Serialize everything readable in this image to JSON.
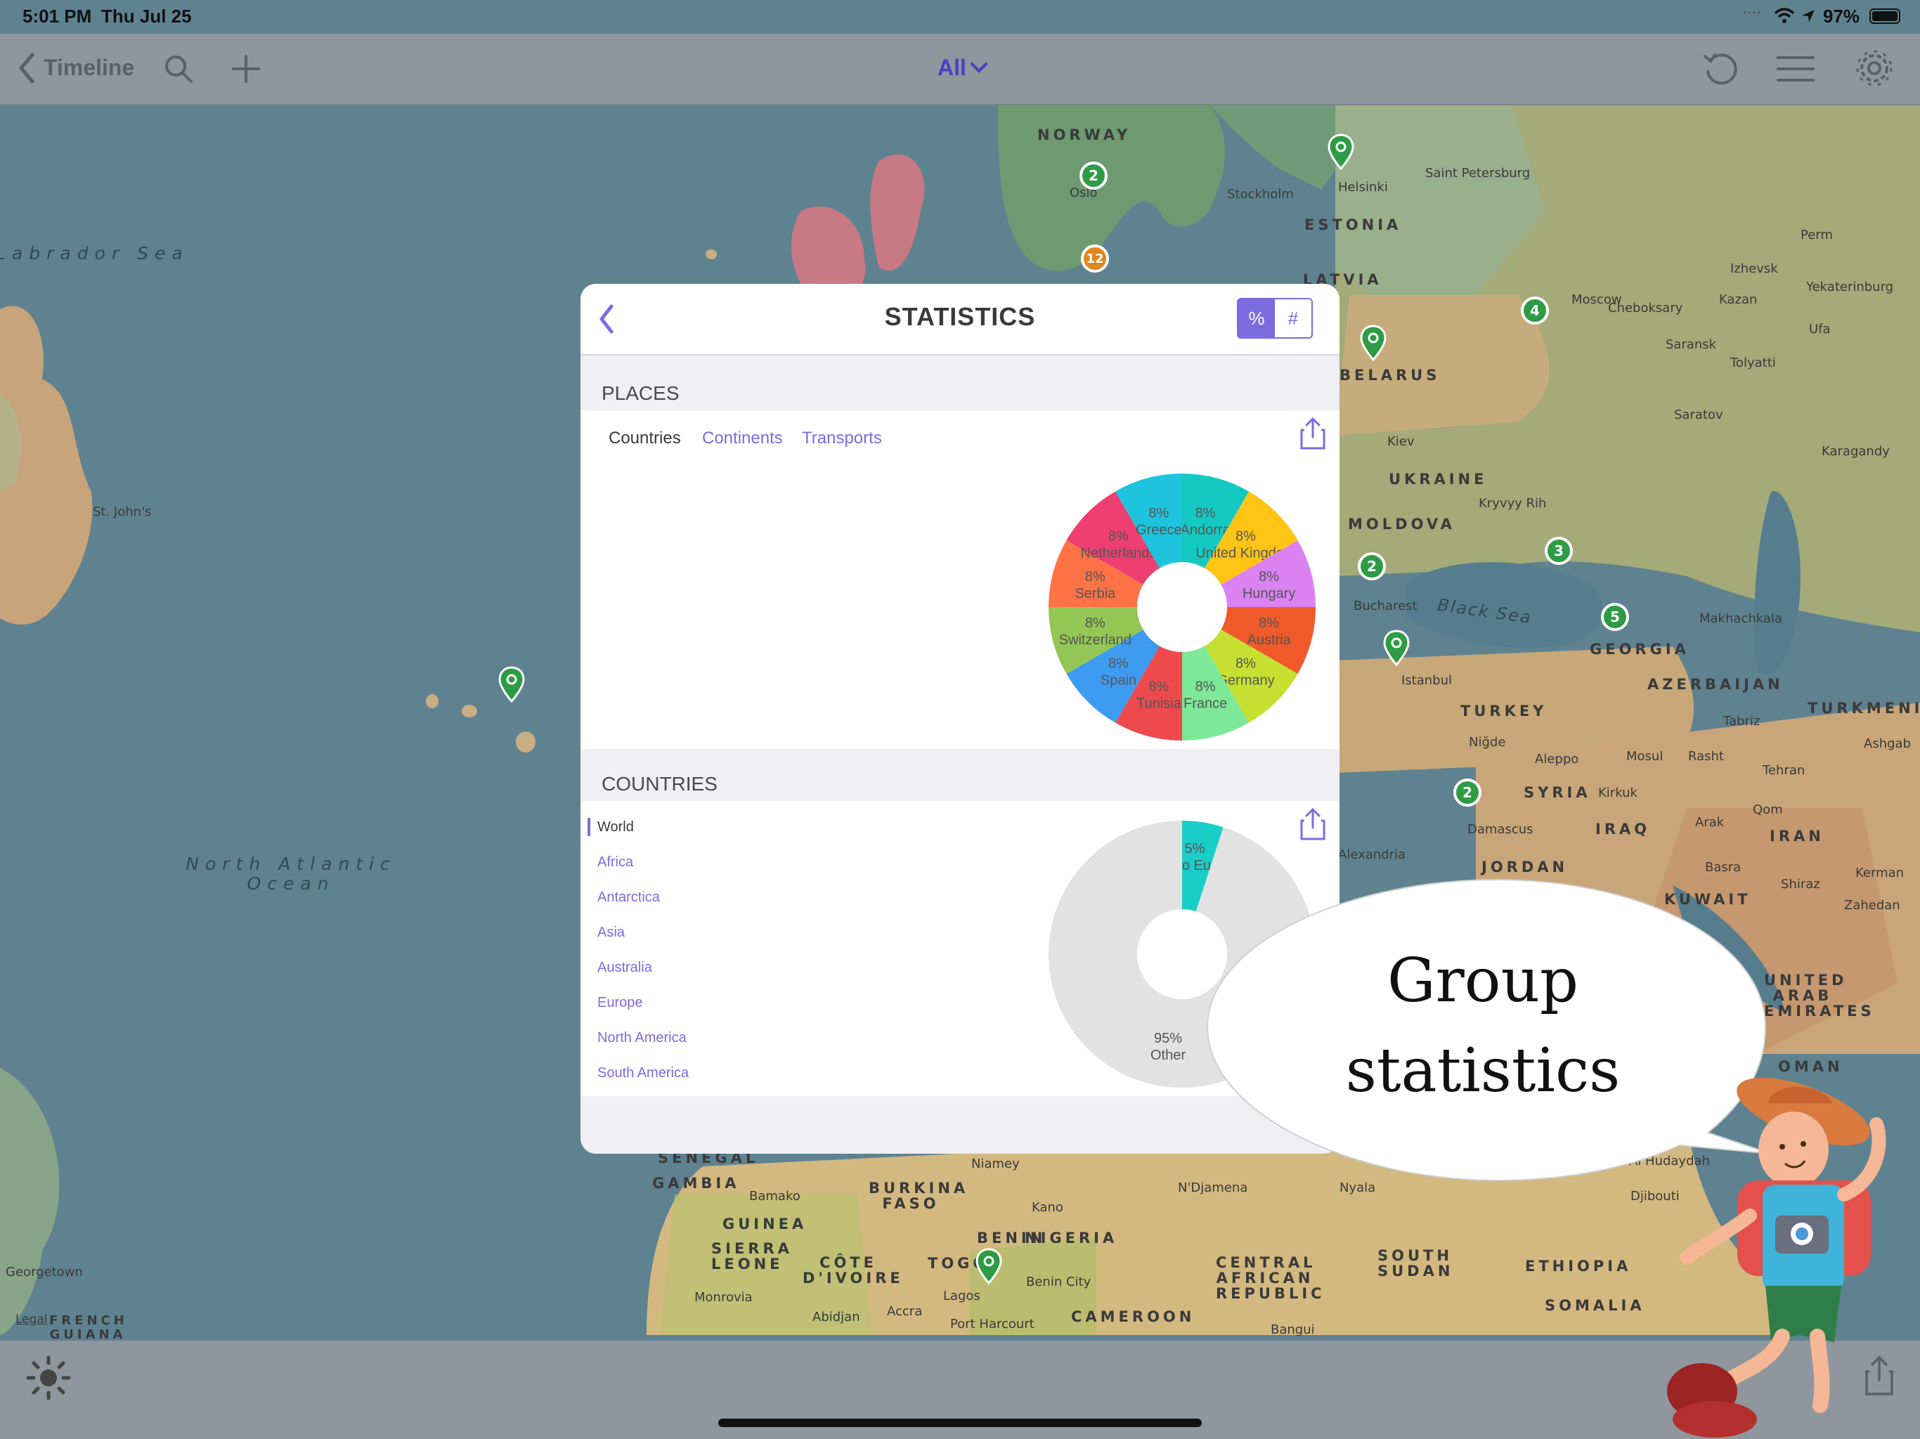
{
  "status_bar": {
    "time": "5:01 PM",
    "date": "Thu Jul 25",
    "battery": "97%"
  },
  "nav": {
    "back_label": "Timeline",
    "filter_label": "All"
  },
  "map": {
    "legal": "Legal",
    "countries": [
      "NORWAY",
      "ESTONIA",
      "LATVIA",
      "BELARUS",
      "UKRAINE",
      "MOLDOVA",
      "GEORGIA",
      "AZERBAIJAN",
      "TURKEY",
      "SYRIA",
      "IRAQ",
      "IRAN",
      "KUWAIT",
      "JORDAN",
      "TURKMENIST",
      "UNITED ARAB EMIRATES",
      "OMAN",
      "SENEGAL",
      "GAMBIA",
      "GUINEA",
      "SIERRA LEONE",
      "BURKINA FASO",
      "BENIN",
      "NIGERIA",
      "TOGO",
      "CÔTE D'IVOIRE",
      "CAMEROON",
      "CENTRAL AFRICAN REPUBLIC",
      "SOUTH SUDAN",
      "ETHIOPIA",
      "SOMALIA",
      "FRENCH GUIANA"
    ],
    "cities": [
      "Oslo",
      "Stockholm",
      "Helsinki",
      "Saint Petersburg",
      "Moscow",
      "Cheboksary",
      "Kazan",
      "Izhevsk",
      "Perm",
      "Yekaterinburg",
      "Ufa",
      "Saransk",
      "Tolyatti",
      "Saratov",
      "Karagandy",
      "Kiev",
      "Kryvyy Rih",
      "Bucharest",
      "Istanbul",
      "Makhachkala",
      "Niğde",
      "Aleppo",
      "Mosul",
      "Rasht",
      "Tehran",
      "Ashgab",
      "Tabriz",
      "Kirkuk",
      "Arak",
      "Qom",
      "Damascus",
      "Basra",
      "Shiraz",
      "Kerman",
      "Zahedan",
      "Alexandria",
      "St. John's",
      "Niamey",
      "N'Djamena",
      "Nyala",
      "Bamako",
      "Kano",
      "Al Hudaydah",
      "Djibouti",
      "Monrovia",
      "Abidjan",
      "Accra",
      "Lagos",
      "Port Harcourt",
      "Benin City",
      "Bangui",
      "Georgetown"
    ],
    "seas": [
      "Labrador Sea",
      "North Atlantic Ocean",
      "Black Sea"
    ],
    "clusters": [
      "2",
      "12",
      "4",
      "3",
      "2",
      "5",
      "2"
    ]
  },
  "statistics": {
    "title": "STATISTICS",
    "toggle": {
      "percent": "%",
      "count": "#"
    },
    "places_label": "PLACES",
    "tabs": [
      "Countries",
      "Continents",
      "Transports"
    ],
    "countries_label": "COUNTRIES",
    "continent_list": [
      "World",
      "Africa",
      "Antarctica",
      "Asia",
      "Australia",
      "Europe",
      "North America",
      "South America"
    ]
  },
  "colors": {
    "accent": "#7d6be0",
    "pin_green": "#2e9b45",
    "cluster_orange": "#e0861f",
    "donut_other": "#e2e2e2",
    "donut_trip": "#19cec7"
  },
  "chart_data": [
    {
      "type": "pie",
      "title": "",
      "labels": [
        "Andorra",
        "United Kingdom",
        "Hungary",
        "Austria",
        "Germany",
        "France",
        "Tunisia",
        "Spain",
        "Switzerland",
        "Serbia",
        "Netherlands",
        "Greece"
      ],
      "values": [
        8,
        8,
        8,
        8,
        8,
        8,
        8,
        8,
        8,
        8,
        8,
        8
      ],
      "value_labels": [
        "8%",
        "8%",
        "8%",
        "8%",
        "8%",
        "8%",
        "8%",
        "8%",
        "8%",
        "8%",
        "8%",
        "8%"
      ],
      "colors": [
        "#13c9c1",
        "#ffc414",
        "#db82f3",
        "#f05a2a",
        "#c6e032",
        "#7de897",
        "#ee4a4d",
        "#3e9bf2",
        "#93c654",
        "#ff7246",
        "#ee3e72",
        "#1ec4dd"
      ]
    },
    {
      "type": "pie",
      "title": "",
      "labels": [
        "Trip to Europe",
        "Other"
      ],
      "values": [
        5,
        95
      ],
      "value_labels": [
        "5%",
        "95%"
      ],
      "colors": [
        "#19cec7",
        "#e2e2e2"
      ]
    }
  ],
  "bubble": {
    "line1": "Group",
    "line2": "statistics"
  }
}
